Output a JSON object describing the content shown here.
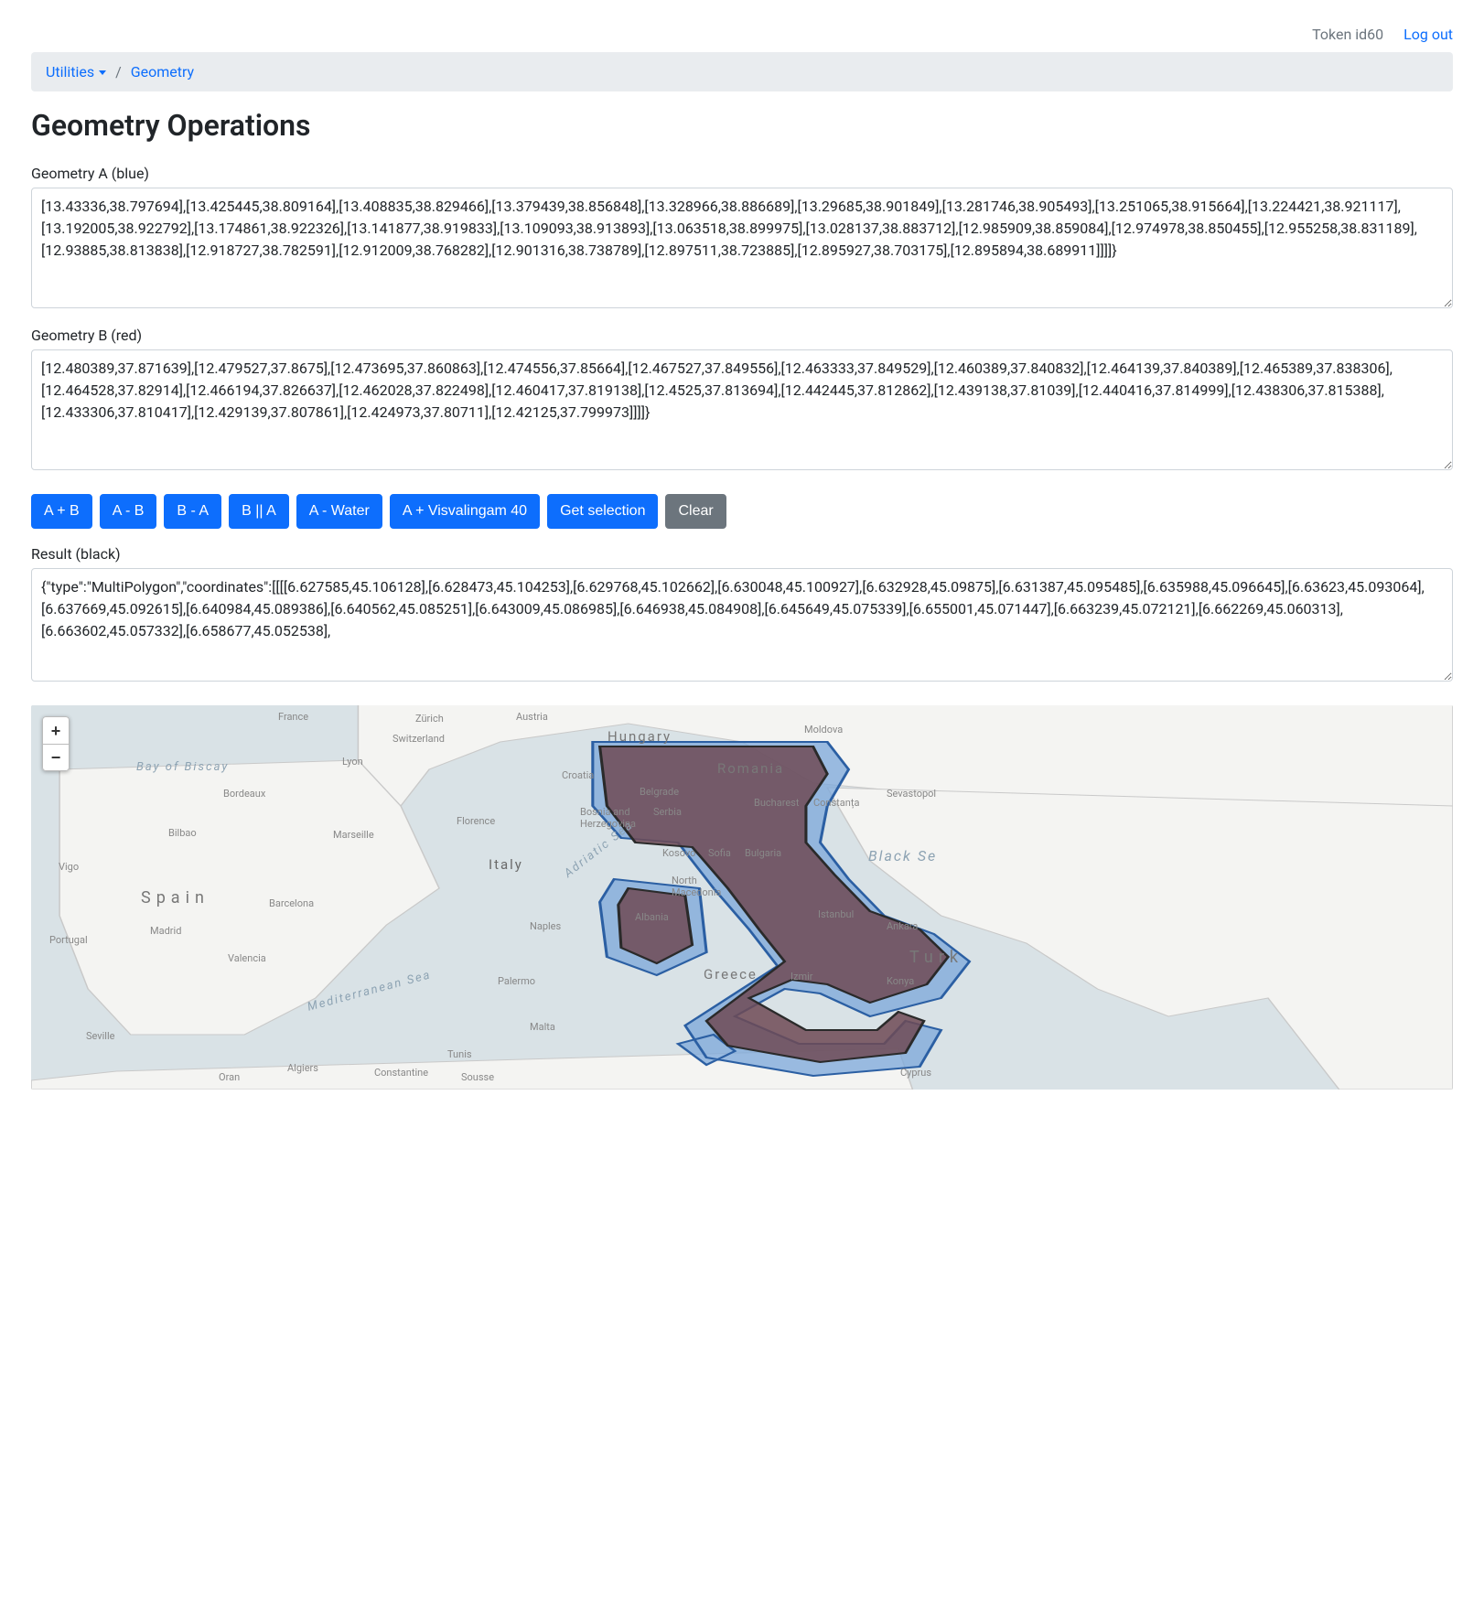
{
  "header": {
    "token_label": "Token id60",
    "logout": "Log out"
  },
  "breadcrumb": {
    "root": "Utilities",
    "current": "Geometry"
  },
  "title": "Geometry Operations",
  "labels": {
    "geom_a": "Geometry A (blue)",
    "geom_b": "Geometry B (red)",
    "result": "Result (black)"
  },
  "textareas": {
    "geom_a": "[13.43336,38.797694],[13.425445,38.809164],[13.408835,38.829466],[13.379439,38.856848],[13.328966,38.886689],[13.29685,38.901849],[13.281746,38.905493],[13.251065,38.915664],[13.224421,38.921117],[13.192005,38.922792],[13.174861,38.922326],[13.141877,38.919833],[13.109093,38.913893],[13.063518,38.899975],[13.028137,38.883712],[12.985909,38.859084],[12.974978,38.850455],[12.955258,38.831189],[12.93885,38.813838],[12.918727,38.782591],[12.912009,38.768282],[12.901316,38.738789],[12.897511,38.723885],[12.895927,38.703175],[12.895894,38.689911]]]]}",
    "geom_b": "[12.480389,37.871639],[12.479527,37.8675],[12.473695,37.860863],[12.474556,37.85664],[12.467527,37.849556],[12.463333,37.849529],[12.460389,37.840832],[12.464139,37.840389],[12.465389,37.838306],[12.464528,37.82914],[12.466194,37.826637],[12.462028,37.822498],[12.460417,37.819138],[12.4525,37.813694],[12.442445,37.812862],[12.439138,37.81039],[12.440416,37.814999],[12.438306,37.815388],[12.433306,37.810417],[12.429139,37.807861],[12.424973,37.80711],[12.42125,37.799973]]]]}",
    "result": "{\"type\":\"MultiPolygon\",\"coordinates\":[[[[6.627585,45.106128],[6.628473,45.104253],[6.629768,45.102662],[6.630048,45.100927],[6.632928,45.09875],[6.631387,45.095485],[6.635988,45.096645],[6.63623,45.093064],[6.637669,45.092615],[6.640984,45.089386],[6.640562,45.085251],[6.643009,45.086985],[6.646938,45.084908],[6.645649,45.075339],[6.655001,45.071447],[6.663239,45.072121],[6.662269,45.060313],[6.663602,45.057332],[6.658677,45.052538],"
  },
  "buttons": {
    "a_plus_b": "A + B",
    "a_minus_b": "A - B",
    "b_minus_a": "B - A",
    "b_or_a": "B || A",
    "a_minus_water": "A - Water",
    "a_plus_visvalingam": "A + Visvalingam 40",
    "get_selection": "Get selection",
    "clear": "Clear"
  },
  "map": {
    "zoom_in": "+",
    "zoom_out": "−",
    "countries": {
      "spain": "Spain",
      "france": "France",
      "switzerland": "Switzerland",
      "austria": "Austria",
      "hungary": "Hungary",
      "romania": "Romania",
      "moldova": "Moldova",
      "croatia": "Croatia",
      "serbia": "Serbia",
      "bosnia": "Bosnia and\nHerzegovina",
      "kosovo": "Kosovo",
      "bulgaria": "Bulgaria",
      "nmacedonia": "North\nMacedonia",
      "albania": "Albania",
      "greece": "Greece",
      "turkey": "Turk",
      "portugal": "Portugal",
      "italy": "Italy",
      "malta": "Malta",
      "cyprus": "Cyprus"
    },
    "cities": {
      "bilbao": "Bilbao",
      "madrid": "Madrid",
      "barcelona": "Barcelona",
      "valencia": "Valencia",
      "seville": "Seville",
      "vigo": "Vigo",
      "lyon": "Lyon",
      "bordeaux": "Bordeaux",
      "zurich": "Zürich",
      "marseille": "Marseille",
      "florence": "Florence",
      "naples": "Naples",
      "palermo": "Palermo",
      "belgrade": "Belgrade",
      "bucharest": "Bucharest",
      "sofia": "Sofia",
      "istanbul": "Istanbul",
      "ankara": "Ankara",
      "izmir": "Izmir",
      "konya": "Konya",
      "algiers": "Algiers",
      "oran": "Oran",
      "constantine": "Constantine",
      "tunis": "Tunis",
      "sousse": "Sousse",
      "sevastopol": "Sevastopol",
      "constanta": "Constanța"
    },
    "seas": {
      "biscay": "Bay of\nBiscay",
      "med": "Mediterranean Sea",
      "adriatic": "Adriatic Sea",
      "blacksea": "Black Se"
    }
  }
}
